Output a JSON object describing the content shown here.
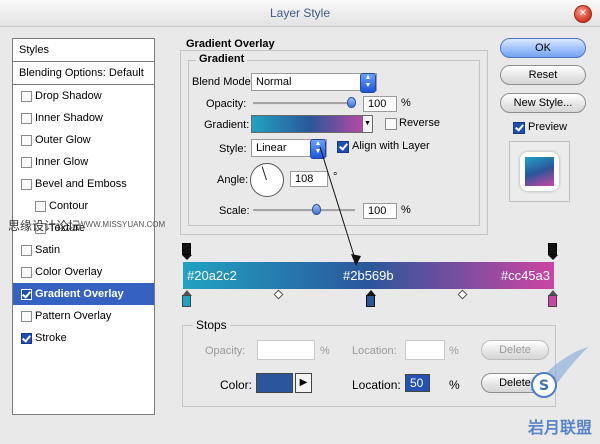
{
  "window": {
    "title": "Layer Style"
  },
  "left_panel": {
    "styles_header": "Styles",
    "blending_header": "Blending Options: Default",
    "items": [
      {
        "label": "Drop Shadow",
        "checked": false,
        "sub": false,
        "selected": false
      },
      {
        "label": "Inner Shadow",
        "checked": false,
        "sub": false,
        "selected": false
      },
      {
        "label": "Outer Glow",
        "checked": false,
        "sub": false,
        "selected": false
      },
      {
        "label": "Inner Glow",
        "checked": false,
        "sub": false,
        "selected": false
      },
      {
        "label": "Bevel and Emboss",
        "checked": false,
        "sub": false,
        "selected": false
      },
      {
        "label": "Contour",
        "checked": false,
        "sub": true,
        "selected": false
      },
      {
        "label": "Texture",
        "checked": false,
        "sub": true,
        "selected": false
      },
      {
        "label": "Satin",
        "checked": false,
        "sub": false,
        "selected": false
      },
      {
        "label": "Color Overlay",
        "checked": false,
        "sub": false,
        "selected": false
      },
      {
        "label": "Gradient Overlay",
        "checked": true,
        "sub": false,
        "selected": true
      },
      {
        "label": "Pattern Overlay",
        "checked": false,
        "sub": false,
        "selected": false
      },
      {
        "label": "Stroke",
        "checked": true,
        "sub": false,
        "selected": false
      }
    ]
  },
  "gradient_overlay": {
    "section_title": "Gradient Overlay",
    "group_title": "Gradient",
    "blend_mode_label": "Blend Mode:",
    "blend_mode_value": "Normal",
    "opacity_label": "Opacity:",
    "opacity_value": "100",
    "opacity_unit": "%",
    "gradient_label": "Gradient:",
    "reverse_label": "Reverse",
    "style_label": "Style:",
    "style_value": "Linear",
    "align_label": "Align with Layer",
    "angle_label": "Angle:",
    "angle_value": "108",
    "angle_unit": "°",
    "scale_label": "Scale:",
    "scale_value": "100",
    "scale_unit": "%"
  },
  "gradient_bar": {
    "stop_left": "#20a2c2",
    "stop_mid": "#2b569b",
    "stop_right": "#cc45a3"
  },
  "stops": {
    "title": "Stops",
    "opacity_label": "Opacity:",
    "opacity_unit": "%",
    "location_label": "Location:",
    "location_unit": "%",
    "delete_label": "Delete",
    "color_label": "Color:",
    "color_swatch": "#2b569b",
    "location2_label": "Location:",
    "location2_value": "50",
    "location2_unit": "%",
    "delete2_label": "Delete"
  },
  "buttons": {
    "ok": "OK",
    "reset": "Reset",
    "new_style": "New Style...",
    "preview": "Preview"
  },
  "watermark": {
    "left_text": "思缘设计论坛",
    "left_url": "WWW.MISSYUAN.COM",
    "right_text": "岩月联盟"
  }
}
